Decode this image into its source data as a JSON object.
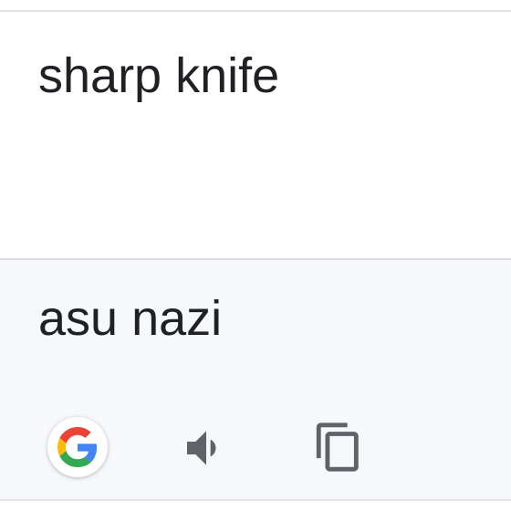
{
  "source": {
    "text": "sharp knife"
  },
  "translation": {
    "text": "asu nazi"
  },
  "actions": {
    "google_icon": "google-g-icon",
    "speak_icon": "speaker-icon",
    "copy_icon": "copy-icon"
  },
  "colors": {
    "text": "#202124",
    "result_background": "#f6f8fb",
    "icon": "#5f6368",
    "google_blue": "#4285F4",
    "google_red": "#EA4335",
    "google_yellow": "#FBBC05",
    "google_green": "#34A853"
  }
}
